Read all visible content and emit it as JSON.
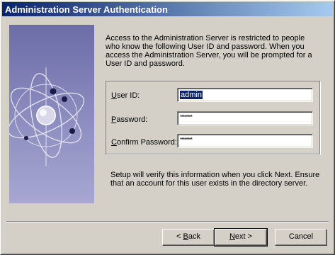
{
  "window": {
    "title": "Administration Server Authentication"
  },
  "description": "Access to the Administration Server is restricted to people who know the following User ID and password.  When you access the Administration Server, you will be prompted for a User ID and password.",
  "form": {
    "user_id_label_pre": "",
    "user_id_label_u": "U",
    "user_id_label_post": "ser ID:",
    "user_id_value": "admin",
    "password_label_pre": "",
    "password_label_u": "P",
    "password_label_post": "assword:",
    "password_value": "********",
    "confirm_label_pre": "",
    "confirm_label_u": "C",
    "confirm_label_post": "onfirm Password:",
    "confirm_value": "********"
  },
  "note": "Setup will verify this information when you click Next.  Ensure that an account for this user exists in the directory server.",
  "buttons": {
    "back_u": "B",
    "back_pre": "< ",
    "back_post": "ack",
    "next_u": "N",
    "next_post": "ext >",
    "cancel": "Cancel"
  },
  "colors": {
    "titlebar_start": "#0a246a",
    "titlebar_end": "#a6caf0",
    "dialog_face": "#d4d0c8",
    "art_panel": "#8888bc"
  }
}
